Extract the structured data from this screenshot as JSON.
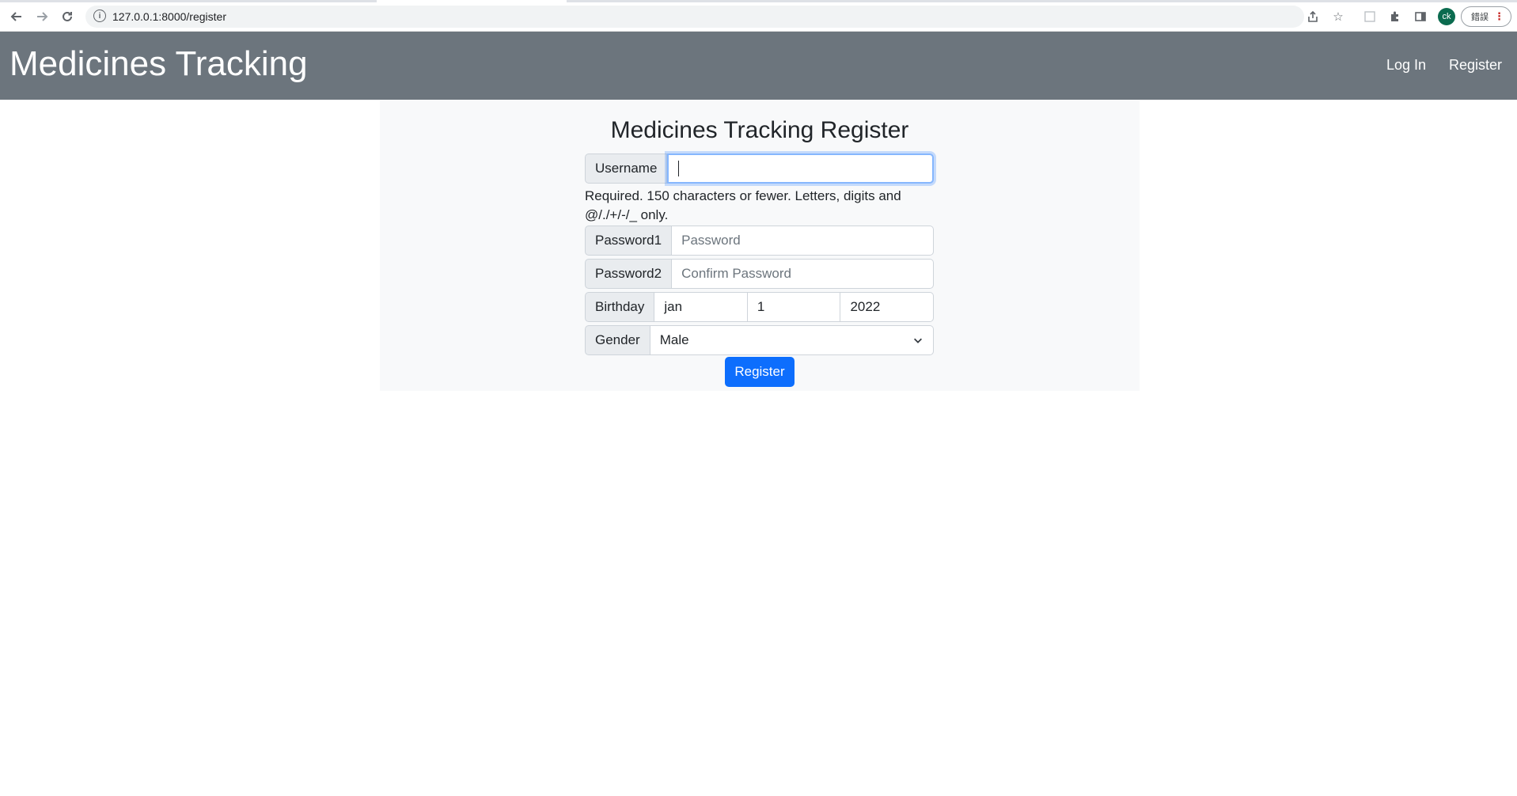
{
  "browser": {
    "url": "127.0.0.1:8000/register",
    "profile_initials": "ck",
    "error_label": "錯誤"
  },
  "navbar": {
    "brand": "Medicines Tracking",
    "links": [
      "Log In",
      "Register"
    ]
  },
  "form": {
    "title": "Medicines Tracking Register",
    "username": {
      "label": "Username",
      "value": "",
      "help": "Required. 150 characters or fewer. Letters, digits and @/./+/-/_ only."
    },
    "password1": {
      "label": "Password1",
      "placeholder": "Password"
    },
    "password2": {
      "label": "Password2",
      "placeholder": "Confirm Password"
    },
    "birthday": {
      "label": "Birthday",
      "month": "jan",
      "day": "1",
      "year": "2022"
    },
    "gender": {
      "label": "Gender",
      "selected": "Male"
    },
    "submit_label": "Register"
  }
}
